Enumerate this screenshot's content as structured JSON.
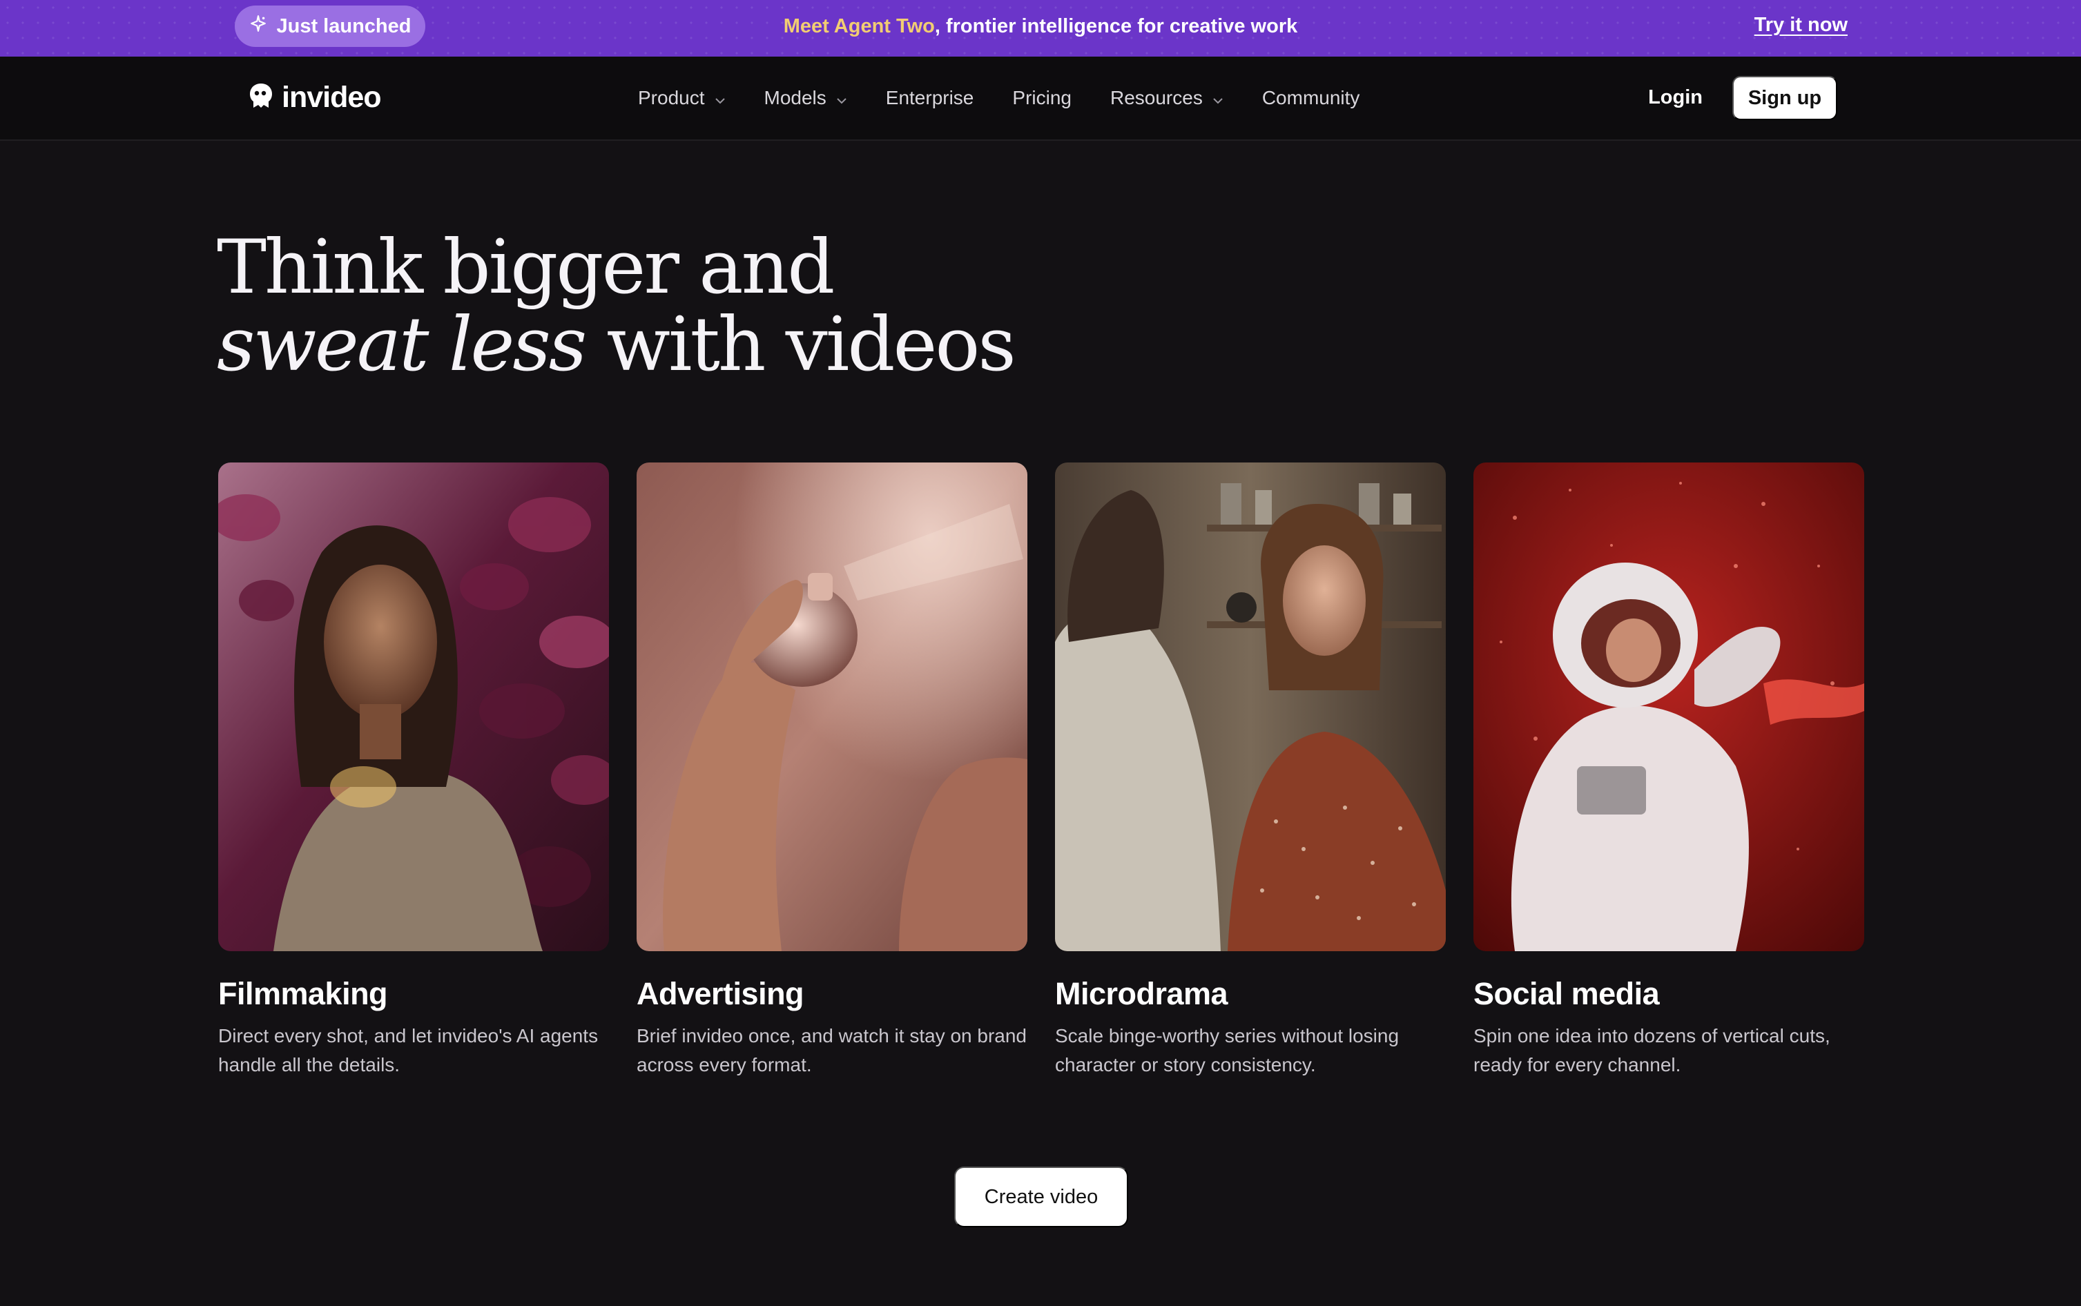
{
  "announcement": {
    "badge_icon": "sparkle-icon",
    "badge_label": "Just launched",
    "highlight": "Meet Agent Two",
    "message": ", frontier intelligence for creative work",
    "link_label": "Try it now",
    "highlight_color": "#f2cd72",
    "background_color": "#6b35c9"
  },
  "nav": {
    "logo_text": "invideo",
    "logo_icon": "invideo-logo-icon",
    "items": [
      {
        "label": "Product",
        "has_dropdown": true
      },
      {
        "label": "Models",
        "has_dropdown": true
      },
      {
        "label": "Enterprise",
        "has_dropdown": false
      },
      {
        "label": "Pricing",
        "has_dropdown": false
      },
      {
        "label": "Resources",
        "has_dropdown": true
      },
      {
        "label": "Community",
        "has_dropdown": false
      }
    ],
    "login_label": "Login",
    "signup_label": "Sign up"
  },
  "hero": {
    "headline_line1": "Think bigger and",
    "headline_italic": "sweat less",
    "headline_line2_rest": " with videos"
  },
  "cards": [
    {
      "title": "Filmmaking",
      "description": "Direct every shot, and let invideo's AI agents handle all the details.",
      "image": "woman-in-foliage-image"
    },
    {
      "title": "Advertising",
      "description": "Brief invideo once, and watch it stay on brand across every format.",
      "image": "perfume-spray-image"
    },
    {
      "title": "Microdrama",
      "description": "Scale binge-worthy series without losing character or story consistency.",
      "image": "kitchen-couple-image"
    },
    {
      "title": "Social media",
      "description": "Spin one idea into dozens of vertical cuts, ready for every channel.",
      "image": "astronaut-image"
    }
  ],
  "cta": {
    "label": "Create video"
  }
}
